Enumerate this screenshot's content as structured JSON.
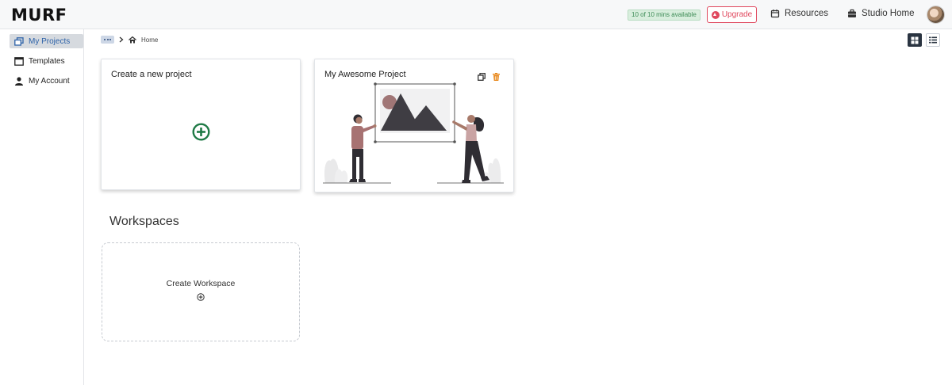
{
  "app": {
    "logo": "MURF"
  },
  "header": {
    "mins_badge": "10 of 10 mins available",
    "upgrade_label": "Upgrade",
    "resources_label": "Resources",
    "studio_home_label": "Studio Home"
  },
  "sidebar": {
    "items": [
      {
        "label": "My Projects",
        "icon": "projects-icon",
        "active": true
      },
      {
        "label": "Templates",
        "icon": "templates-icon",
        "active": false
      },
      {
        "label": "My Account",
        "icon": "user-icon",
        "active": false
      }
    ]
  },
  "breadcrumb": {
    "home_label": "Home"
  },
  "cards": {
    "new_project_label": "Create a new project",
    "project_title": "My Awesome Project"
  },
  "workspaces": {
    "heading": "Workspaces",
    "create_label": "Create Workspace"
  },
  "colors": {
    "accent_green": "#1f7a46",
    "upgrade_red": "#e0485e",
    "delete_orange": "#e8891d",
    "active_blue": "#2c61a8"
  }
}
